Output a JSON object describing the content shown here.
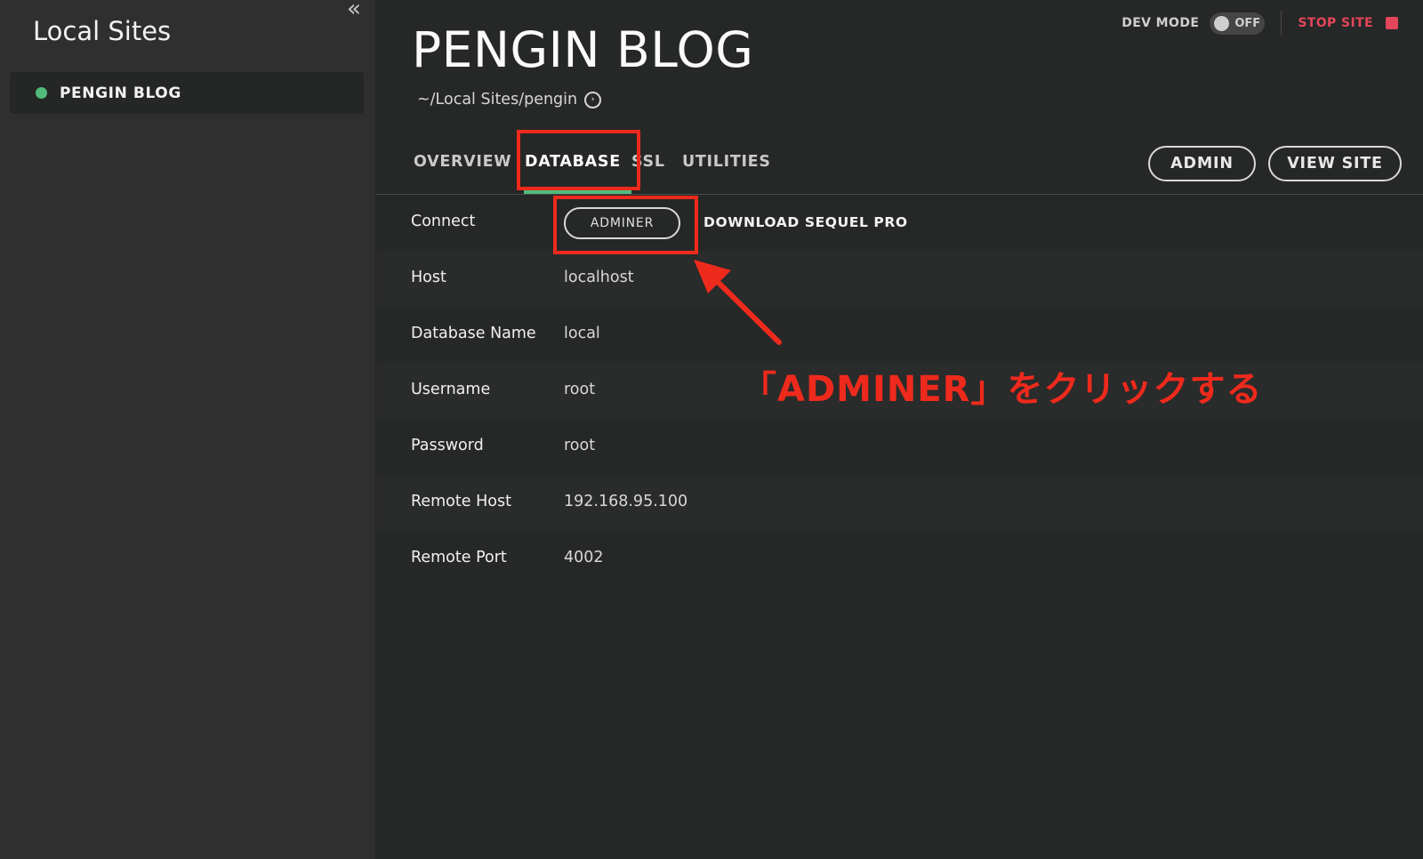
{
  "sidebar": {
    "title": "Local Sites",
    "collapse_icon": "«",
    "sites": [
      {
        "label": "PENGIN BLOG",
        "status": "running"
      }
    ]
  },
  "header": {
    "title": "PENGIN BLOG",
    "path": "~/Local Sites/pengin",
    "path_icon": "›",
    "dev_mode_label": "DEV MODE",
    "dev_mode_state": "OFF",
    "stop_label": "STOP SITE"
  },
  "tabs": [
    {
      "label": "OVERVIEW",
      "active": false
    },
    {
      "label": "DATABASE",
      "active": true
    },
    {
      "label": "SSL",
      "active": false
    },
    {
      "label": "UTILITIES",
      "active": false
    }
  ],
  "actions": {
    "admin": "ADMIN",
    "view_site": "VIEW SITE"
  },
  "database": {
    "connect_label": "Connect",
    "adminer_label": "ADMINER",
    "sequel_label": "DOWNLOAD SEQUEL PRO",
    "rows": [
      {
        "label": "Host",
        "value": "localhost"
      },
      {
        "label": "Database Name",
        "value": "local"
      },
      {
        "label": "Username",
        "value": "root"
      },
      {
        "label": "Password",
        "value": "root"
      },
      {
        "label": "Remote Host",
        "value": "192.168.95.100"
      },
      {
        "label": "Remote Port",
        "value": "4002"
      }
    ]
  },
  "annotation": {
    "text": "「ADMINER」をクリックする"
  },
  "colors": {
    "accent_green": "#51bb7b",
    "stop_red": "#e1465b",
    "annotation_red": "#ee2a1c"
  }
}
